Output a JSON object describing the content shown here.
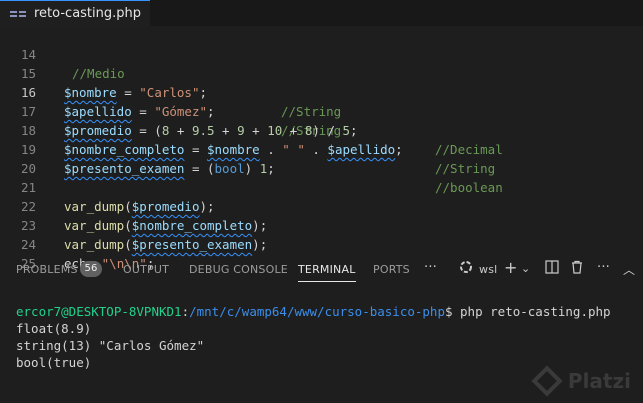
{
  "tab": {
    "filename": "reto-casting.php",
    "icon": "php-file-icon"
  },
  "editor": {
    "line_numbers": [
      "14",
      "15",
      "16",
      "17",
      "18",
      "19",
      "20",
      "21",
      "22",
      "23",
      "24",
      "25"
    ],
    "active_line": "16",
    "lines": {
      "l14": {
        "comment": "//Medio"
      },
      "l15": {
        "var": "$nombre",
        "op": " = ",
        "str": "\"Carlos\"",
        "end": ";",
        "comment": "//String"
      },
      "l16": {
        "var": "$apellido",
        "op": " = ",
        "str": "\"Gómez\"",
        "end": ";",
        "comment": "//String"
      },
      "l17": {
        "var": "$promedio",
        "op": " = (",
        "n1": "8",
        "p1": " + ",
        "n2": "9.5",
        "p2": " + ",
        "n3": "9",
        "p3": " + ",
        "n4": "10",
        "p4": " + ",
        "n5": "8",
        "p5": ") / ",
        "n6": "5",
        "end": ";",
        "comment": "//Decimal"
      },
      "l18": {
        "var": "$nombre_completo",
        "op": " = ",
        "var2": "$nombre",
        "op2": " . ",
        "str": "\" \"",
        "op3": " . ",
        "var3": "$apellido",
        "end": ";",
        "comment": "//String"
      },
      "l19": {
        "var": "$presento_examen",
        "op": " = (",
        "kw": "bool",
        "op2": ") ",
        "num": "1",
        "end": ";",
        "comment": "//boolean"
      },
      "l21": {
        "fn": "var_dump",
        "open": "(",
        "var": "$promedio",
        "close": ");"
      },
      "l22": {
        "fn": "var_dump",
        "open": "(",
        "var": "$nombre_completo",
        "close": ");"
      },
      "l23": {
        "fn": "var_dump",
        "open": "(",
        "var": "$presento_examen",
        "close": ");"
      },
      "l24": {
        "kw": "echo",
        "sp": " ",
        "q1": "\"",
        "esc": "\\n\\n",
        "q2": "\"",
        "end": ";"
      }
    }
  },
  "panel": {
    "tabs": {
      "problems": "PROBLEMS",
      "problems_count": "56",
      "output": "OUTPUT",
      "debug": "DEBUG CONSOLE",
      "terminal": "TERMINAL",
      "ports": "PORTS"
    },
    "terminal_profile": "wsl",
    "icons": [
      "more-icon",
      "wsl-terminal-icon",
      "add-terminal-icon",
      "dropdown-icon",
      "split-terminal-icon",
      "trash-icon",
      "more-icon",
      "maximize-icon"
    ]
  },
  "terminal": {
    "prompt_user": "ercor7@DESKTOP-8VPNKD1",
    "prompt_sep": ":",
    "prompt_path": "/mnt/c/wamp64/www/curso-basico-php",
    "prompt_cmd": "$ php reto-casting.php",
    "output": [
      "float(8.9)",
      "string(13) \"Carlos Gómez\"",
      "bool(true)"
    ]
  },
  "watermark": {
    "text": "Platzi"
  }
}
